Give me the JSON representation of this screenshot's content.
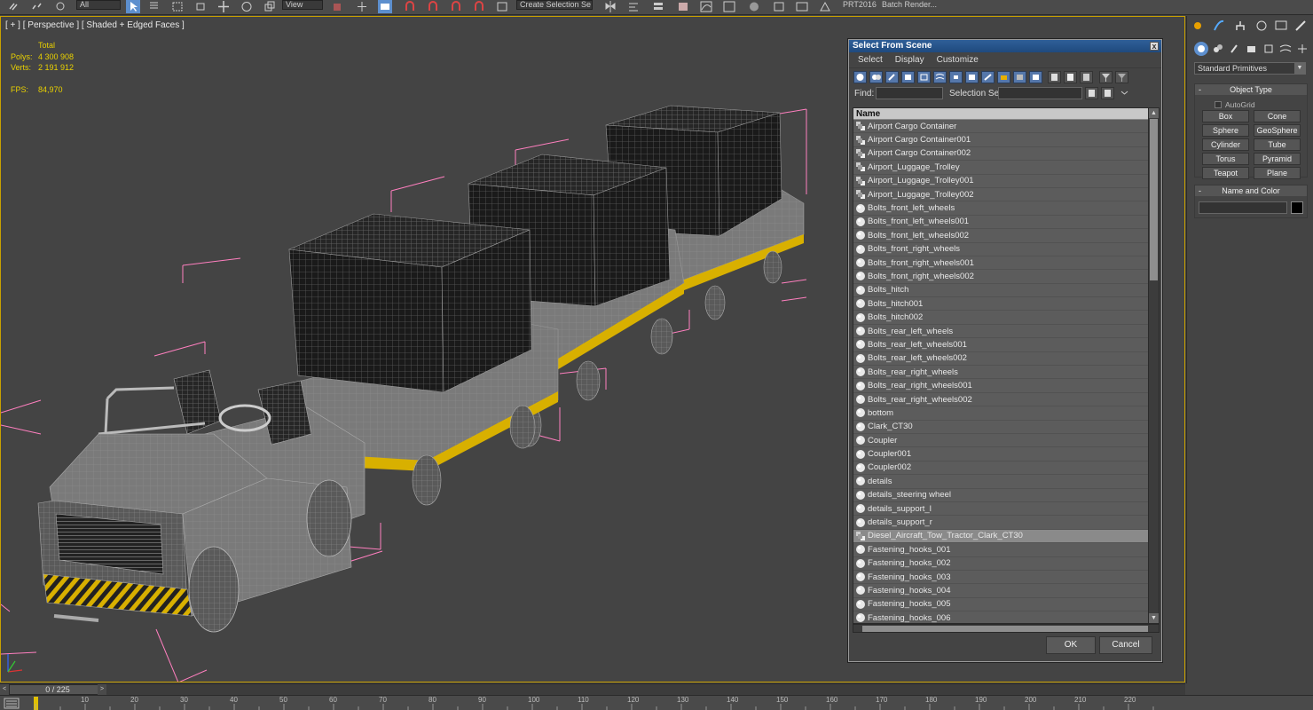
{
  "toolbar": {
    "selection_filter": "All",
    "view_dropdown": "View",
    "named_selection": "Create Selection Se",
    "workspace_label": "PRT2016",
    "batch_render": "Batch Render..."
  },
  "viewport": {
    "label": "[ + ] [ Perspective ] [ Shaded + Edged Faces ]",
    "stats_header": "Total",
    "polys_label": "Polys:",
    "polys_value": "4 300 908",
    "verts_label": "Verts:",
    "verts_value": "2 191 912",
    "fps_label": "FPS:",
    "fps_value": "84,970"
  },
  "dialog": {
    "title": "Select From Scene",
    "close": "x",
    "menu": [
      "Select",
      "Display",
      "Customize"
    ],
    "find_label": "Find:",
    "selection_set_label": "Selection Set:",
    "column_header": "Name",
    "items": [
      {
        "name": "Airport Cargo Container",
        "type": "group"
      },
      {
        "name": "Airport Cargo Container001",
        "type": "group"
      },
      {
        "name": "Airport Cargo Container002",
        "type": "group"
      },
      {
        "name": "Airport_Luggage_Trolley",
        "type": "group"
      },
      {
        "name": "Airport_Luggage_Trolley001",
        "type": "group"
      },
      {
        "name": "Airport_Luggage_Trolley002",
        "type": "group"
      },
      {
        "name": "Bolts_front_left_wheels",
        "type": "geometry"
      },
      {
        "name": "Bolts_front_left_wheels001",
        "type": "geometry"
      },
      {
        "name": "Bolts_front_left_wheels002",
        "type": "geometry"
      },
      {
        "name": "Bolts_front_right_wheels",
        "type": "geometry"
      },
      {
        "name": "Bolts_front_right_wheels001",
        "type": "geometry"
      },
      {
        "name": "Bolts_front_right_wheels002",
        "type": "geometry"
      },
      {
        "name": "Bolts_hitch",
        "type": "geometry"
      },
      {
        "name": "Bolts_hitch001",
        "type": "geometry"
      },
      {
        "name": "Bolts_hitch002",
        "type": "geometry"
      },
      {
        "name": "Bolts_rear_left_wheels",
        "type": "geometry"
      },
      {
        "name": "Bolts_rear_left_wheels001",
        "type": "geometry"
      },
      {
        "name": "Bolts_rear_left_wheels002",
        "type": "geometry"
      },
      {
        "name": "Bolts_rear_right_wheels",
        "type": "geometry"
      },
      {
        "name": "Bolts_rear_right_wheels001",
        "type": "geometry"
      },
      {
        "name": "Bolts_rear_right_wheels002",
        "type": "geometry"
      },
      {
        "name": "bottom",
        "type": "geometry"
      },
      {
        "name": "Clark_CT30",
        "type": "geometry"
      },
      {
        "name": "Coupler",
        "type": "geometry"
      },
      {
        "name": "Coupler001",
        "type": "geometry"
      },
      {
        "name": "Coupler002",
        "type": "geometry"
      },
      {
        "name": "details",
        "type": "geometry"
      },
      {
        "name": "details_steering wheel",
        "type": "geometry"
      },
      {
        "name": "details_support_l",
        "type": "geometry"
      },
      {
        "name": "details_support_r",
        "type": "geometry"
      },
      {
        "name": "Diesel_Aircraft_Tow_Tractor_Clark_CT30",
        "type": "group",
        "selected": true
      },
      {
        "name": "Fastening_hooks_001",
        "type": "geometry"
      },
      {
        "name": "Fastening_hooks_002",
        "type": "geometry"
      },
      {
        "name": "Fastening_hooks_003",
        "type": "geometry"
      },
      {
        "name": "Fastening_hooks_004",
        "type": "geometry"
      },
      {
        "name": "Fastening_hooks_005",
        "type": "geometry"
      },
      {
        "name": "Fastening_hooks_006",
        "type": "geometry"
      }
    ],
    "ok_label": "OK",
    "cancel_label": "Cancel"
  },
  "command_panel": {
    "primitive_dropdown": "Standard Primitives",
    "object_type_title": "Object Type",
    "autogrid_label": "AutoGrid",
    "primitives": [
      "Box",
      "Cone",
      "Sphere",
      "GeoSphere",
      "Cylinder",
      "Tube",
      "Torus",
      "Pyramid",
      "Teapot",
      "Plane"
    ],
    "name_color_title": "Name and Color",
    "rollout_toggle": "-"
  },
  "timeline": {
    "frame_display": "0 / 225",
    "left_arrow": "<",
    "right_arrow": ">",
    "ticks": [
      "10",
      "20",
      "30",
      "40",
      "50",
      "60",
      "70",
      "80",
      "90",
      "100",
      "110",
      "120",
      "130",
      "140",
      "150",
      "160",
      "170",
      "180",
      "190",
      "200",
      "210",
      "220"
    ]
  },
  "colors": {
    "selection_blue": "#5d8fce",
    "viewport_border": "#c8a000",
    "stats_yellow": "#e8d000",
    "bbox_pink": "#ff7fbf"
  }
}
